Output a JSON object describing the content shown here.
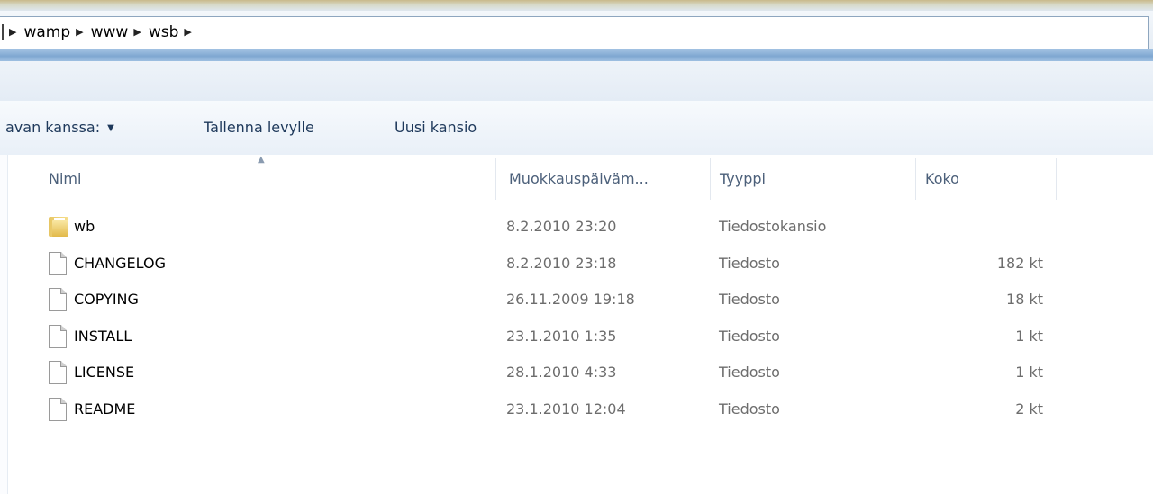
{
  "breadcrumb": {
    "items": [
      "wamp",
      "www",
      "wsb"
    ]
  },
  "commands": {
    "share_label": "avan kanssa:",
    "burn_label": "Tallenna levylle",
    "new_folder_label": "Uusi kansio"
  },
  "columns": {
    "name": "Nimi",
    "date": "Muokkauspäiväm...",
    "type": "Tyyppi",
    "size": "Koko"
  },
  "files": [
    {
      "name": "wb",
      "date": "8.2.2010 23:20",
      "type": "Tiedostokansio",
      "size": "",
      "icon": "folder-icon"
    },
    {
      "name": "CHANGELOG",
      "date": "8.2.2010 23:18",
      "type": "Tiedosto",
      "size": "182 kt",
      "icon": "file-icon"
    },
    {
      "name": "COPYING",
      "date": "26.11.2009 19:18",
      "type": "Tiedosto",
      "size": "18 kt",
      "icon": "file-icon"
    },
    {
      "name": "INSTALL",
      "date": "23.1.2010 1:35",
      "type": "Tiedosto",
      "size": "1 kt",
      "icon": "file-icon"
    },
    {
      "name": "LICENSE",
      "date": "28.1.2010 4:33",
      "type": "Tiedosto",
      "size": "1 kt",
      "icon": "file-icon"
    },
    {
      "name": "README",
      "date": "23.1.2010 12:04",
      "type": "Tiedosto",
      "size": "2 kt",
      "icon": "file-icon"
    }
  ]
}
